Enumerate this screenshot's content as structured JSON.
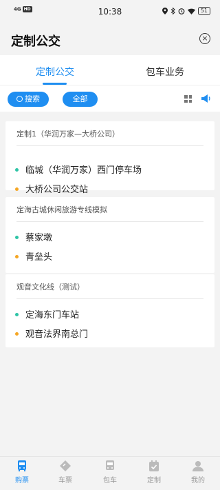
{
  "status": {
    "network": "4G",
    "hd": "HD",
    "time": "10:38",
    "battery": "51"
  },
  "header": {
    "title": "定制公交",
    "close_icon": "close-circle-icon"
  },
  "tabs": [
    {
      "label": "定制公交",
      "active": true
    },
    {
      "label": "包车业务",
      "active": false
    }
  ],
  "filters": {
    "search_label": "搜索",
    "all_label": "全部"
  },
  "routes": [
    {
      "title": "定制1（华润万家—大桥公司）",
      "stops": [
        "临城（华润万家）西门停车场",
        "大桥公司公交站"
      ]
    },
    {
      "title": "定海古城休闲旅游专线模拟",
      "stops": [
        "蔡家墩",
        "青垒头"
      ]
    },
    {
      "title": "观音文化线（测试）",
      "stops": [
        "定海东门车站",
        "观音法界南总门"
      ]
    }
  ],
  "bottom_nav": [
    {
      "label": "购票",
      "icon": "bus-icon",
      "active": true
    },
    {
      "label": "车票",
      "icon": "ticket-icon",
      "active": false
    },
    {
      "label": "包车",
      "icon": "charter-bus-icon",
      "active": false
    },
    {
      "label": "定制",
      "icon": "calendar-check-icon",
      "active": false
    },
    {
      "label": "我的",
      "icon": "user-icon",
      "active": false
    }
  ],
  "colors": {
    "accent": "#1f8ef1",
    "start_dot": "#2ec4a6",
    "end_dot": "#f5a623"
  }
}
